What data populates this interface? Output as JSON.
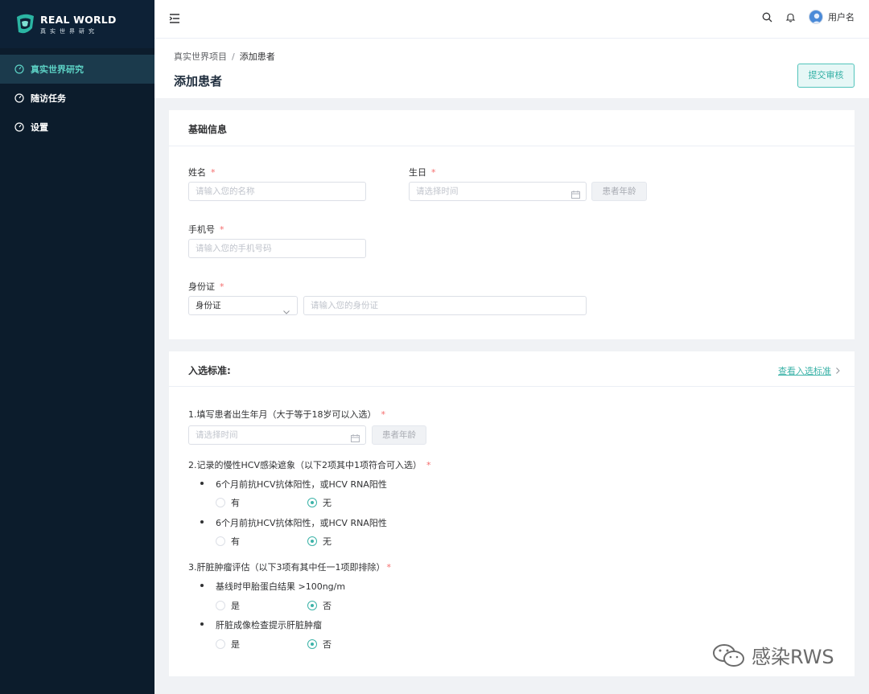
{
  "brand": {
    "title": "REAL WORLD",
    "subtitle": "真实世界研究"
  },
  "sidebar": {
    "items": [
      {
        "label": "真实世界研究",
        "active": true
      },
      {
        "label": "随访任务",
        "active": false
      },
      {
        "label": "设置",
        "active": false
      }
    ]
  },
  "header": {
    "username": "用户名",
    "icons": [
      "menu-fold-icon",
      "search-icon",
      "bell-icon",
      "avatar"
    ]
  },
  "breadcrumb": {
    "parent": "真实世界项目",
    "separator": "/",
    "current": "添加患者"
  },
  "page": {
    "title": "添加患者",
    "submit_label": "提交审核"
  },
  "basic": {
    "title": "基础信息",
    "name_label": "姓名",
    "name_placeholder": "请输入您的名称",
    "birthday_label": "生日",
    "birthday_placeholder": "请选择时间",
    "age_button": "患者年龄",
    "phone_label": "手机号",
    "phone_placeholder": "请输入您的手机号码",
    "id_label": "身份证",
    "id_type_value": "身份证",
    "id_placeholder": "请输入您的身份证",
    "required_mark": "*"
  },
  "criteria": {
    "title": "入选标准:",
    "view_link": "查看入选标准",
    "q1": "1.填写患者出生年月（大于等于18岁可以入选）",
    "q1_placeholder": "请选择时间",
    "q1_age_button": "患者年龄",
    "q2": "2.记录的慢性HCV感染遮象（以下2项其中1项符合可入选）",
    "q2_items": [
      {
        "text": "6个月前抗HCV抗体阳性，或HCV RNA阳性",
        "opt_a": "有",
        "opt_b": "无",
        "selected": "无"
      },
      {
        "text": "6个月前抗HCV抗体阳性，或HCV RNA阳性",
        "opt_a": "有",
        "opt_b": "无",
        "selected": "无"
      }
    ],
    "q3": "3.肝脏肿瘤评估（以下3项有其中任一1项即排除）",
    "q3_items": [
      {
        "text": "基线时甲胎蛋白结果 >100ng/m",
        "opt_a": "是",
        "opt_b": "否",
        "selected": "否"
      },
      {
        "text": "肝脏成像检查提示肝脏肿瘤",
        "opt_a": "是",
        "opt_b": "否",
        "selected": "否"
      }
    ]
  },
  "watermark": {
    "text": "感染RWS"
  },
  "colors": {
    "accent": "#3cb3a8",
    "sidebar_bg": "#0c1c2c",
    "required": "#f56c6c"
  }
}
